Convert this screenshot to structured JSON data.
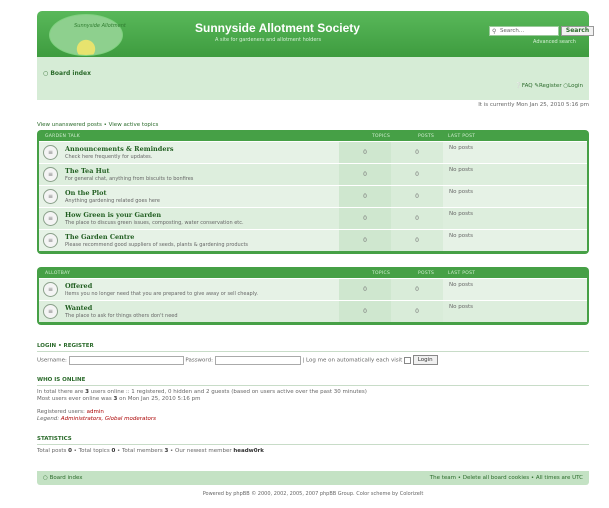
{
  "header": {
    "logo_text": "Sunnyside Allotment",
    "title": "Sunnyside Allotment Society",
    "description": "A site for gardeners and allotment holders",
    "search_placeholder": "Search...",
    "search_button": "Search",
    "advanced_search": "Advanced search"
  },
  "nav": {
    "board_index": "Board index",
    "faq": "FAQ",
    "register": "Register",
    "login": "Login",
    "date": "It is currently Mon Jan 25, 2010 5:16 pm",
    "view_unanswered": "View unanswered posts",
    "sep": " • ",
    "view_active": "View active topics"
  },
  "categories": [
    {
      "name": "GARDEN TALK",
      "topics_label": "TOPICS",
      "posts_label": "POSTS",
      "last_label": "LAST POST",
      "forums": [
        {
          "name": "Announcements & Reminders",
          "desc": "Check here frequently for updates.",
          "topics": "0",
          "posts": "0",
          "last": "No posts"
        },
        {
          "name": "The Tea Hut",
          "desc": "For general chat, anything from biscuits to bonfires",
          "topics": "0",
          "posts": "0",
          "last": "No posts"
        },
        {
          "name": "On the Plot",
          "desc": "Anything gardening related goes here",
          "topics": "0",
          "posts": "0",
          "last": "No posts"
        },
        {
          "name": "How Green is your Garden",
          "desc": "The place to discuss green issues, composting, water conservation etc.",
          "topics": "0",
          "posts": "0",
          "last": "No posts"
        },
        {
          "name": "The Garden Centre",
          "desc": "Please recommend good suppliers of seeds, plants & gardening products",
          "topics": "0",
          "posts": "0",
          "last": "No posts"
        }
      ]
    },
    {
      "name": "ALLOTBAY",
      "topics_label": "TOPICS",
      "posts_label": "POSTS",
      "last_label": "LAST POST",
      "forums": [
        {
          "name": "Offered",
          "desc": "Items you no longer need that you are prepared to give away or sell cheaply.",
          "topics": "0",
          "posts": "0",
          "last": "No posts"
        },
        {
          "name": "Wanted",
          "desc": "The place to ask for things others don't need",
          "topics": "0",
          "posts": "0",
          "last": "No posts"
        }
      ]
    }
  ],
  "login": {
    "title": "LOGIN • REGISTER",
    "username_label": "Username:",
    "password_label": "Password:",
    "remember_label": "| Log me on automatically each visit",
    "button": "Login"
  },
  "online": {
    "title": "WHO IS ONLINE",
    "line1_a": "In total there are ",
    "total_users": "3",
    "line1_b": " users online :: 1 registered, 0 hidden and 2 guests (based on users active over the past 30 minutes)",
    "line2_a": "Most users ever online was ",
    "max_users": "3",
    "line2_b": " on Mon Jan 25, 2010 5:16 pm",
    "registered_label": "Registered users: ",
    "registered_user": "admin",
    "legend_label": "Legend: ",
    "legend_values": "Administrators, Global moderators"
  },
  "stats": {
    "title": "STATISTICS",
    "posts_label": "Total posts ",
    "posts_value": "0",
    "topics_label": " • Total topics ",
    "topics_value": "0",
    "members_label": " • Total members ",
    "members_value": "3",
    "newest_label": " • Our newest member ",
    "newest_member": "headw0rk"
  },
  "footer": {
    "board_index": "Board index",
    "right_links": "The team • Delete all board cookies • All times are UTC",
    "copyright": "Powered by phpBB © 2000, 2002, 2005, 2007 phpBB Group. Color scheme by ColorizeIt"
  }
}
